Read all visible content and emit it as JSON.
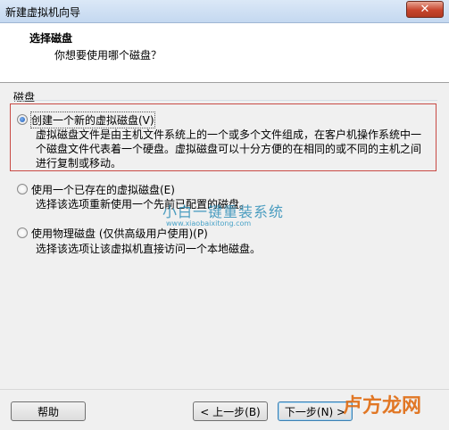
{
  "window": {
    "title": "新建虚拟机向导",
    "close_label": "✕"
  },
  "header": {
    "title": "选择磁盘",
    "subtitle": "你想要使用哪个磁盘？"
  },
  "group": {
    "label": "磁盘"
  },
  "options": [
    {
      "label": "创建一个新的虚拟磁盘(V)",
      "selected": true,
      "desc": [
        "虚拟磁盘文件是由主机文件系统上的一个或多个文件组成，在客户机操作系统中一",
        "个磁盘文件代表着一个硬盘。虚拟磁盘可以十分方便的在相同的或不同的主机之间",
        "进行复制或移动。"
      ]
    },
    {
      "label": "使用一个已存在的虚拟磁盘(E)",
      "selected": false,
      "desc": [
        "选择该选项重新使用一个先前已配置的磁盘。"
      ]
    },
    {
      "label": "使用物理磁盘 (仅供高级用户使用)(P)",
      "selected": false,
      "desc": [
        "选择该选项让该虚拟机直接访问一个本地磁盘。"
      ]
    }
  ],
  "watermark": {
    "text": "小白一键重装系统",
    "url": "www.xiaobaixitong.com",
    "corner_text": "卢方龙网"
  },
  "buttons": {
    "help": "帮助",
    "back": "< 上一步(B)",
    "next": "下一步(N) >"
  }
}
